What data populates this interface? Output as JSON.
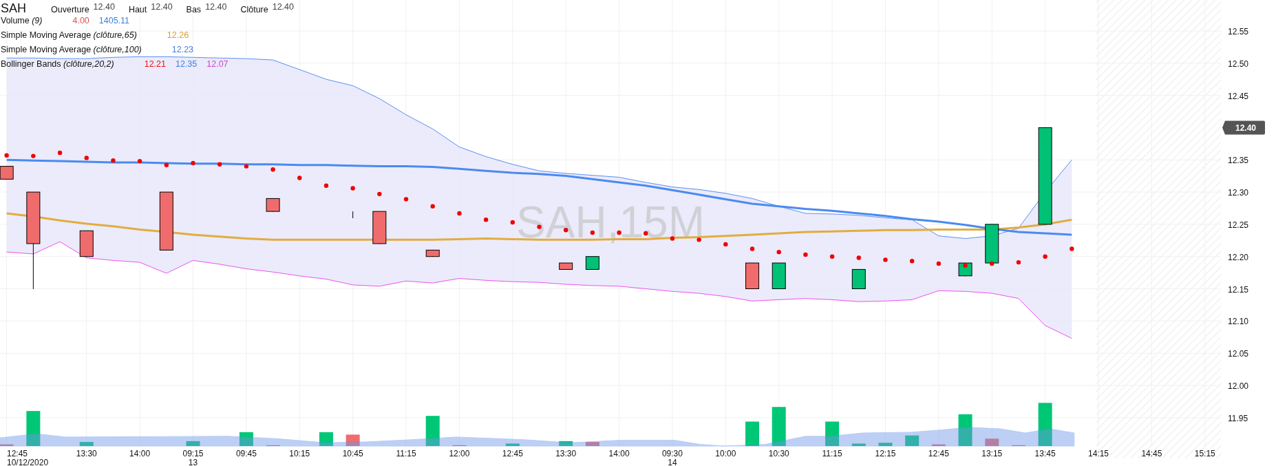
{
  "legend": {
    "symbol": "SAH",
    "ohlc": [
      {
        "label": "Ouverture",
        "value": "12.40"
      },
      {
        "label": "Haut",
        "value": "12.40"
      },
      {
        "label": "Bas",
        "value": "12.40"
      },
      {
        "label": "Clôture",
        "value": "12.40"
      }
    ],
    "indicators": [
      {
        "name": "Volume",
        "params": "(9)",
        "values": [
          {
            "text": "4.00",
            "color": "#e05050"
          },
          {
            "text": "1405.11",
            "color": "#3d7fe0"
          }
        ]
      },
      {
        "name": "Simple Moving Average",
        "params": "(clôture,65)",
        "values": [
          {
            "text": "12.26",
            "color": "#d4a03a"
          }
        ]
      },
      {
        "name": "Simple Moving Average",
        "params": "(clôture,100)",
        "values": [
          {
            "text": "12.23",
            "color": "#3d7fe0"
          }
        ]
      },
      {
        "name": "Bollinger Bands",
        "params": "(clôture,20,2)",
        "values": [
          {
            "text": "12.21",
            "color": "#f01010"
          },
          {
            "text": "12.35",
            "color": "#3d7fe0"
          },
          {
            "text": "12.07",
            "color": "#d040d0"
          }
        ]
      }
    ]
  },
  "watermark": "SAH,15M",
  "last_price": "12.40",
  "y_axis_labels": [
    "12.55",
    "12.50",
    "12.45",
    "12.35",
    "12.30",
    "12.25",
    "12.20",
    "12.15",
    "12.10",
    "12.05",
    "12.00",
    "11.95"
  ],
  "x_axis_labels": [
    {
      "time": "12:45",
      "date": "10/12/2020"
    },
    {
      "time": "13:30"
    },
    {
      "time": "14:00"
    },
    {
      "time": "09:15",
      "date": "13"
    },
    {
      "time": "09:45"
    },
    {
      "time": "10:15"
    },
    {
      "time": "10:45"
    },
    {
      "time": "11:15"
    },
    {
      "time": "12:00"
    },
    {
      "time": "12:45"
    },
    {
      "time": "13:30"
    },
    {
      "time": "14:00"
    },
    {
      "time": "09:30",
      "date": "14"
    },
    {
      "time": "10:00"
    },
    {
      "time": "10:30"
    },
    {
      "time": "11:15"
    },
    {
      "time": "12:15"
    },
    {
      "time": "12:45"
    },
    {
      "time": "13:15"
    },
    {
      "time": "13:45"
    },
    {
      "time": "14:15"
    },
    {
      "time": "14:45"
    },
    {
      "time": "15:15"
    }
  ]
}
